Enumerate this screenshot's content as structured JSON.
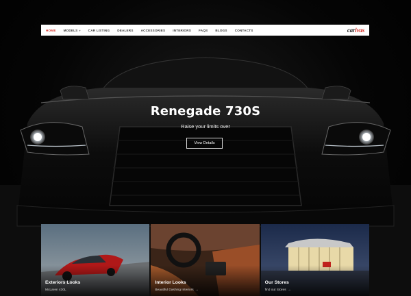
{
  "nav": {
    "items": [
      {
        "label": "HOME",
        "active": true
      },
      {
        "label": "MODELS",
        "dropdown": true
      },
      {
        "label": "CAR LISTING"
      },
      {
        "label": "DEALERS"
      },
      {
        "label": "ACCESSORIES"
      },
      {
        "label": "INTERIORS"
      },
      {
        "label": "FAQS"
      },
      {
        "label": "BLOGS"
      },
      {
        "label": "CONTACTS"
      }
    ],
    "logo_part1": "car",
    "logo_part2": "ivas"
  },
  "hero": {
    "title": "Renegade 730S",
    "subtitle": "Raise your limits over",
    "button_label": "View Details"
  },
  "cards": [
    {
      "title": "Exteriors Looks",
      "subtitle": "McLaren 430L",
      "icon": "none"
    },
    {
      "title": "Interior Looks",
      "subtitle": "Beautiful Dashing Interiors",
      "icon": "arrow-right-icon"
    },
    {
      "title": "Our Stores",
      "subtitle": "find out Stores",
      "icon": "arrow-right-icon"
    }
  ],
  "colors": {
    "accent": "#d8322a",
    "background": "#000000",
    "nav_bg": "#ffffff"
  }
}
